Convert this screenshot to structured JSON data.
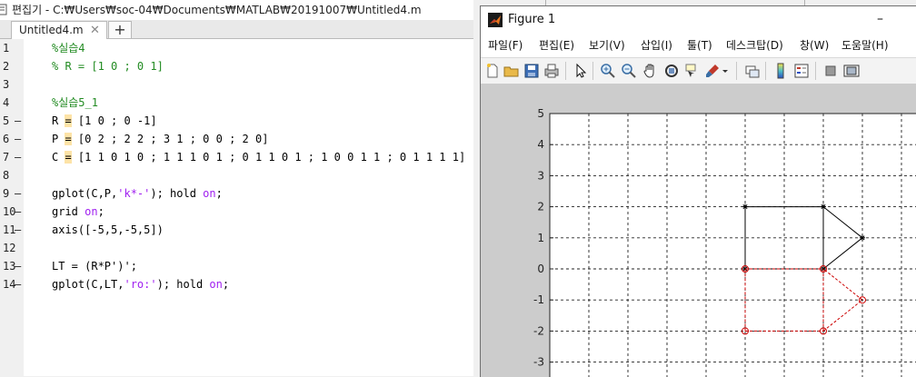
{
  "editor": {
    "title": "편집기 - C:₩Users₩soc-04₩Documents₩MATLAB₩20191007₩Untitled4.m",
    "tab": {
      "label": "Untitled4.m",
      "close_glyph": "✕"
    },
    "add_tab_glyph": "+",
    "lines": [
      {
        "n": "1",
        "dash": "",
        "segments": [
          {
            "t": "%실습4",
            "c": "comment"
          }
        ]
      },
      {
        "n": "2",
        "dash": "",
        "segments": [
          {
            "t": "% R = [1 0 ; 0 1]",
            "c": "comment"
          }
        ]
      },
      {
        "n": "3",
        "dash": "",
        "segments": []
      },
      {
        "n": "4",
        "dash": "",
        "segments": [
          {
            "t": "%실습5_1",
            "c": "comment"
          }
        ]
      },
      {
        "n": "5",
        "dash": "–",
        "segments": [
          {
            "t": "R ",
            "c": ""
          },
          {
            "t": "=",
            "c": "hl"
          },
          {
            "t": " [1 0 ; 0 -1]",
            "c": ""
          }
        ]
      },
      {
        "n": "6",
        "dash": "–",
        "segments": [
          {
            "t": "P ",
            "c": ""
          },
          {
            "t": "=",
            "c": "hl"
          },
          {
            "t": " [0 2 ; 2 2 ; 3 1 ; 0 0 ; 2 0]",
            "c": ""
          }
        ]
      },
      {
        "n": "7",
        "dash": "–",
        "segments": [
          {
            "t": "C ",
            "c": ""
          },
          {
            "t": "=",
            "c": "hl"
          },
          {
            "t": " [1 1 0 1 0 ; 1 1 1 0 1 ; 0 1 1 0 1 ; 1 0 0 1 1 ; 0 1 1 1 1]",
            "c": ""
          }
        ]
      },
      {
        "n": "8",
        "dash": "",
        "segments": []
      },
      {
        "n": "9",
        "dash": "–",
        "segments": [
          {
            "t": "gplot(C,P,",
            "c": ""
          },
          {
            "t": "'k*-'",
            "c": "str"
          },
          {
            "t": "); hold ",
            "c": ""
          },
          {
            "t": "on",
            "c": "kw"
          },
          {
            "t": ";",
            "c": ""
          }
        ]
      },
      {
        "n": "10",
        "dash": "–",
        "segments": [
          {
            "t": "grid ",
            "c": ""
          },
          {
            "t": "on",
            "c": "kw"
          },
          {
            "t": ";",
            "c": ""
          }
        ]
      },
      {
        "n": "11",
        "dash": "–",
        "segments": [
          {
            "t": "axis([-5,5,-5,5])",
            "c": ""
          }
        ]
      },
      {
        "n": "12",
        "dash": "",
        "segments": []
      },
      {
        "n": "13",
        "dash": "–",
        "segments": [
          {
            "t": "LT = (R*P')';",
            "c": ""
          }
        ]
      },
      {
        "n": "14",
        "dash": "–",
        "segments": [
          {
            "t": "gplot(C,LT,",
            "c": ""
          },
          {
            "t": "'ro:'",
            "c": "str"
          },
          {
            "t": "); hold ",
            "c": ""
          },
          {
            "t": "on",
            "c": "kw"
          },
          {
            "t": ";",
            "c": ""
          }
        ]
      }
    ]
  },
  "figure": {
    "title": "Figure 1",
    "minimize_glyph": "–",
    "menu": [
      "파일(F)",
      "편집(E)",
      "보기(V)",
      "삽입(I)",
      "툴(T)",
      "데스크탑(D)",
      "창(W)",
      "도움말(H)"
    ],
    "toolbar_icons": [
      "new-figure-icon",
      "open-file-icon",
      "save-icon",
      "print-icon",
      "pointer-icon",
      "zoom-in-icon",
      "zoom-out-icon",
      "pan-icon",
      "rotate-icon",
      "data-cursor-icon",
      "brush-icon",
      "link-icon",
      "colorbar-icon",
      "legend-icon",
      "hide-plot-tools-icon",
      "show-plot-tools-icon"
    ],
    "colors": {
      "black_series": "#000000",
      "red_series": "#cc0000",
      "canvas_bg": "#cccccc"
    }
  },
  "chart_data": {
    "type": "line",
    "grid": true,
    "xlim": [
      -5,
      5
    ],
    "ylim": [
      -5,
      5
    ],
    "yticks_visible": [
      "5",
      "4",
      "3",
      "2",
      "1",
      "0",
      "-1",
      "-2",
      "-3"
    ],
    "series": [
      {
        "style": "k*-",
        "color": "#000000",
        "segments": [
          [
            [
              0,
              2
            ],
            [
              2,
              2
            ]
          ],
          [
            [
              2,
              2
            ],
            [
              3,
              1
            ]
          ],
          [
            [
              2,
              2
            ],
            [
              2,
              0
            ]
          ],
          [
            [
              0,
              2
            ],
            [
              0,
              0
            ]
          ],
          [
            [
              3,
              1
            ],
            [
              2,
              0
            ]
          ],
          [
            [
              0,
              0
            ],
            [
              2,
              0
            ]
          ]
        ],
        "points": [
          [
            0,
            2
          ],
          [
            2,
            2
          ],
          [
            3,
            1
          ],
          [
            0,
            0
          ],
          [
            2,
            0
          ]
        ]
      },
      {
        "style": "ro:",
        "color": "#cc0000",
        "segments": [
          [
            [
              0,
              -2
            ],
            [
              2,
              -2
            ]
          ],
          [
            [
              2,
              -2
            ],
            [
              3,
              -1
            ]
          ],
          [
            [
              2,
              -2
            ],
            [
              2,
              0
            ]
          ],
          [
            [
              0,
              -2
            ],
            [
              0,
              0
            ]
          ],
          [
            [
              3,
              -1
            ],
            [
              2,
              0
            ]
          ],
          [
            [
              0,
              0
            ],
            [
              2,
              0
            ]
          ]
        ],
        "points": [
          [
            0,
            -2
          ],
          [
            2,
            -2
          ],
          [
            3,
            -1
          ],
          [
            0,
            0
          ],
          [
            2,
            0
          ]
        ]
      }
    ]
  }
}
